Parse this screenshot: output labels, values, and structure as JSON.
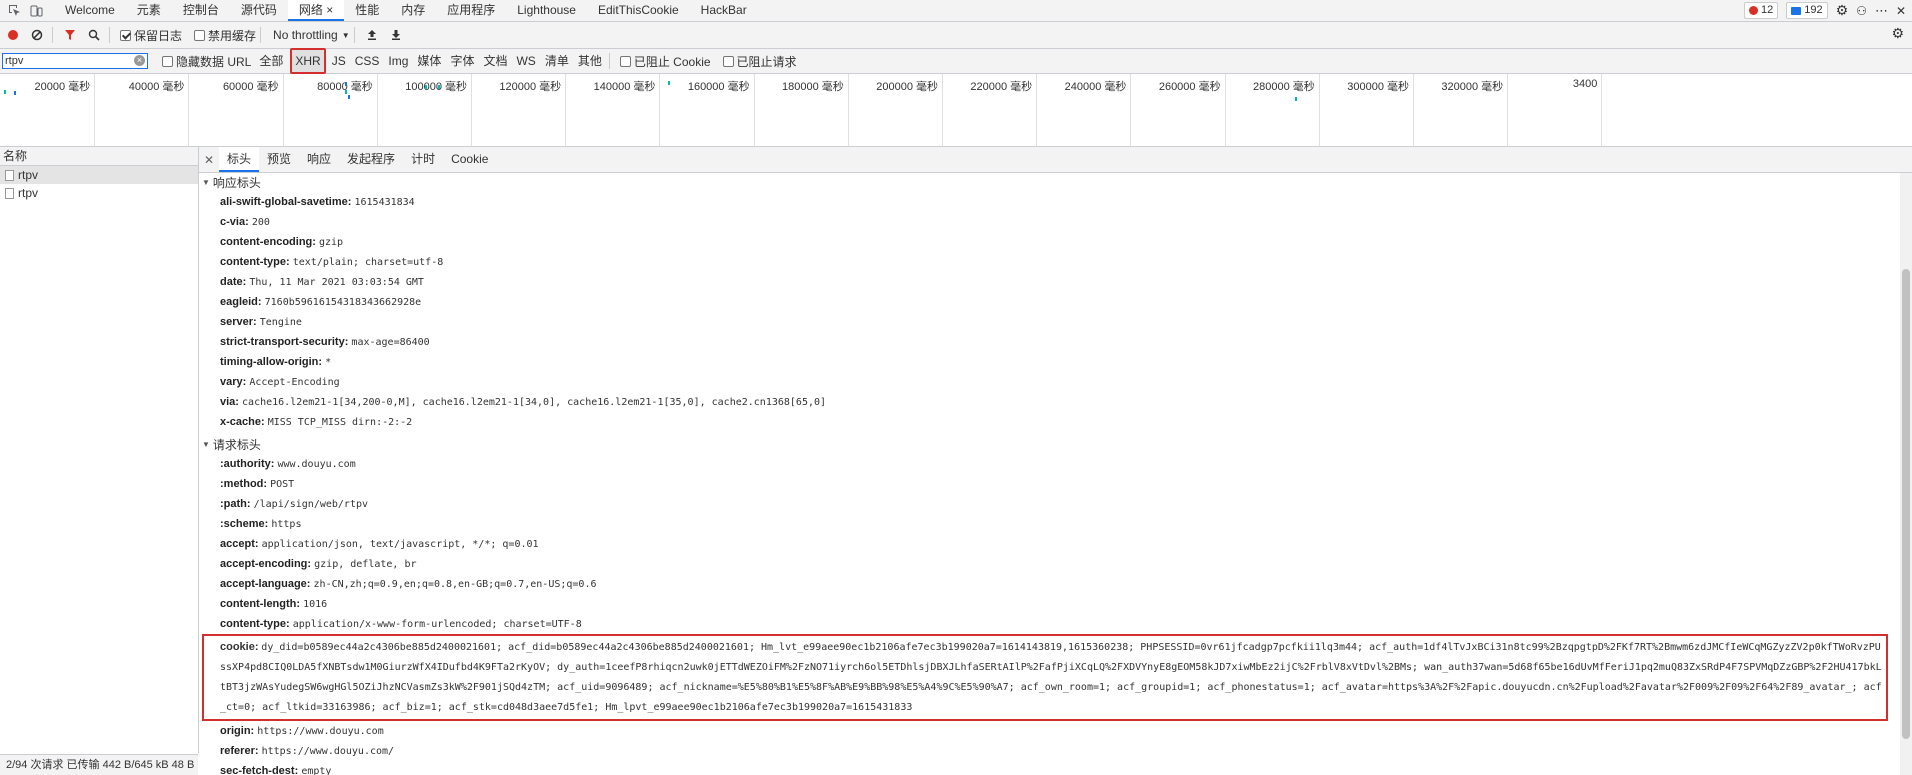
{
  "top_tabs": [
    "Welcome",
    "元素",
    "控制台",
    "源代码",
    "网络",
    "性能",
    "内存",
    "应用程序",
    "Lighthouse",
    "EditThisCookie",
    "HackBar"
  ],
  "active_tab": "网络",
  "errors_count": "12",
  "messages_count": "192",
  "toolbar": {
    "preserve_log": "保留日志",
    "disable_cache": "禁用缓存",
    "throttling": "No throttling"
  },
  "filter": {
    "value": "rtpv",
    "hide_data_url": "隐藏数据 URL",
    "types": [
      "全部",
      "XHR",
      "JS",
      "CSS",
      "Img",
      "媒体",
      "字体",
      "文档",
      "WS",
      "清单",
      "其他"
    ],
    "blocked_cookies": "已阻止 Cookie",
    "blocked_requests": "已阻止请求"
  },
  "timeline_ticks": [
    "20000 毫秒",
    "40000 毫秒",
    "60000 毫秒",
    "80000 毫秒",
    "100000 毫秒",
    "120000 毫秒",
    "140000 毫秒",
    "160000 毫秒",
    "180000 毫秒",
    "200000 毫秒",
    "220000 毫秒",
    "240000 毫秒",
    "260000 毫秒",
    "280000 毫秒",
    "300000 毫秒",
    "320000 毫秒",
    "3400"
  ],
  "list": {
    "header": "名称",
    "rows": [
      "rtpv",
      "rtpv"
    ]
  },
  "status_text": "2/94 次请求  已传输 442 B/645 kB  48 B",
  "detail_tabs": [
    "标头",
    "预览",
    "响应",
    "发起程序",
    "计时",
    "Cookie"
  ],
  "response_headers": {
    "title": "响应标头",
    "rows": [
      {
        "k": "ali-swift-global-savetime:",
        "v": "1615431834"
      },
      {
        "k": "c-via:",
        "v": "200"
      },
      {
        "k": "content-encoding:",
        "v": "gzip"
      },
      {
        "k": "content-type:",
        "v": "text/plain; charset=utf-8"
      },
      {
        "k": "date:",
        "v": "Thu, 11 Mar 2021 03:03:54 GMT"
      },
      {
        "k": "eagleid:",
        "v": "7160b59616154318343662928e"
      },
      {
        "k": "server:",
        "v": "Tengine"
      },
      {
        "k": "strict-transport-security:",
        "v": "max-age=86400"
      },
      {
        "k": "timing-allow-origin:",
        "v": "*"
      },
      {
        "k": "vary:",
        "v": "Accept-Encoding"
      },
      {
        "k": "via:",
        "v": "cache16.l2em21-1[34,200-0,M], cache16.l2em21-1[34,0], cache16.l2em21-1[35,0], cache2.cn1368[65,0]"
      },
      {
        "k": "x-cache:",
        "v": "MISS TCP_MISS dirn:-2:-2"
      }
    ]
  },
  "request_headers": {
    "title": "请求标头",
    "rows": [
      {
        "k": ":authority:",
        "v": "www.douyu.com"
      },
      {
        "k": ":method:",
        "v": "POST"
      },
      {
        "k": ":path:",
        "v": "/lapi/sign/web/rtpv"
      },
      {
        "k": ":scheme:",
        "v": "https"
      },
      {
        "k": "accept:",
        "v": "application/json, text/javascript, */*; q=0.01"
      },
      {
        "k": "accept-encoding:",
        "v": "gzip, deflate, br"
      },
      {
        "k": "accept-language:",
        "v": "zh-CN,zh;q=0.9,en;q=0.8,en-GB;q=0.7,en-US;q=0.6"
      },
      {
        "k": "content-length:",
        "v": "1016"
      },
      {
        "k": "content-type:",
        "v": "application/x-www-form-urlencoded; charset=UTF-8"
      }
    ],
    "cookie_key": "cookie:",
    "cookie_value": "dy_did=b0589ec44a2c4306be885d2400021601; acf_did=b0589ec44a2c4306be885d2400021601; Hm_lvt_e99aee90ec1b2106afe7ec3b199020a7=1614143819,1615360238; PHPSESSID=0vr61jfcadgp7pcfkii1lq3m44; acf_auth=1df4lTvJxBCi31n8tc99%2BzqpgtpD%2FKf7RT%2Bmwm6zdJMCfIeWCqMGZyzZV2p0kfTWoRvzPUssXP4pd8CIQ0LDA5fXNBTsdw1M0GiurzWfX4IDufbd4K9FTa2rKyOV; dy_auth=1ceefP8rhiqcn2uwk0jETTdWEZOiFM%2FzNO71iyrch6ol5ETDhlsjDBXJLhfaSERtAIlP%2FafPjiXCqLQ%2FXDVYnyE8gEOM58kJD7xiwMbEz2ijC%2FrblV8xVtDvl%2BMs; wan_auth37wan=5d68f65be16dUvMfFeriJ1pq2muQ83ZxSRdP4F7SPVMqDZzGBP%2F2HU417bkLtBT3jzWAsYudegSW6wgHGl5OZiJhzNCVasmZs3kW%2F901jSQd4zTM; acf_uid=9096489; acf_nickname=%E5%80%B1%E5%8F%AB%E9%BB%98%E5%A4%9C%E5%90%A7; acf_own_room=1; acf_groupid=1; acf_phonestatus=1; acf_avatar=https%3A%2F%2Fapic.douyucdn.cn%2Fupload%2Favatar%2F009%2F09%2F64%2F89_avatar_; acf_ct=0; acf_ltkid=33163986; acf_biz=1; acf_stk=cd048d3aee7d5fe1; Hm_lpvt_e99aee90ec1b2106afe7ec3b199020a7=1615431833",
    "after_rows": [
      {
        "k": "origin:",
        "v": "https://www.douyu.com"
      },
      {
        "k": "referer:",
        "v": "https://www.douyu.com/"
      },
      {
        "k": "sec-fetch-dest:",
        "v": "empty"
      }
    ]
  },
  "icons": {
    "record": "record-icon",
    "clear": "clear-icon",
    "filter": "filter-icon",
    "search": "search-icon",
    "upload": "import-har-icon",
    "download": "export-har-icon",
    "settings": "gear-icon"
  },
  "colors": {
    "record": "#d93025",
    "filter": "#d93025",
    "highlight_border": "#d32f2f",
    "accent": "#1a73e8"
  }
}
